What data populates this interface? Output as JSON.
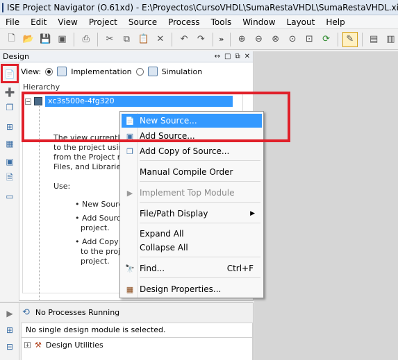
{
  "window": {
    "title": "ISE Project Navigator (O.61xd) - E:\\Proyectos\\CursoVHDL\\SumaRestaVHDL\\SumaRestaVHDL.xise"
  },
  "menubar": [
    "File",
    "Edit",
    "View",
    "Project",
    "Source",
    "Process",
    "Tools",
    "Window",
    "Layout",
    "Help"
  ],
  "toolbar": {
    "left_icons": [
      "new-file-icon",
      "open-folder-icon",
      "save-icon",
      "save-all-icon",
      "print-icon",
      "cut-icon",
      "copy-icon",
      "paste-icon",
      "delete-icon",
      "undo-icon",
      "redo-icon"
    ],
    "more": "»",
    "right_icons": [
      "zoom-in-icon",
      "zoom-out-icon",
      "zoom-fit-icon",
      "zoom-full-icon",
      "zoom-area-icon",
      "refresh-icon",
      "design-goals-icon",
      "pencil-icon",
      "cascade-windows-icon",
      "tile-horizontal-icon",
      "tile-vertical-icon"
    ]
  },
  "design_panel": {
    "title": "Design",
    "controls": [
      "↔",
      "□",
      "⧉",
      "✕"
    ],
    "view_label": "View:",
    "implementation_label": "Implementation",
    "simulation_label": "Simulation",
    "hierarchy_label": "Hierarchy",
    "device": "xc3s500e-4fg320",
    "description_lines": [
      "The view currently c",
      "to the project using",
      "from the Project me",
      "Files, and Libraries p"
    ],
    "use_label": "Use:",
    "bullets": [
      [
        "New Source"
      ],
      [
        "Add Source",
        "project."
      ],
      [
        "Add Copy o",
        "to the proje",
        "project."
      ]
    ]
  },
  "context_menu": {
    "items": [
      {
        "label": "New Source...",
        "icon": "new-source-icon",
        "highlighted": true
      },
      {
        "label": "Add Source...",
        "icon": "add-source-icon"
      },
      {
        "label": "Add Copy of Source...",
        "icon": "add-copy-icon"
      },
      {
        "label": "Manual Compile Order"
      },
      {
        "label": "Implement Top Module",
        "icon": "play-icon",
        "disabled": true
      },
      {
        "label": "File/Path Display",
        "submenu": true
      },
      {
        "label": "Expand All"
      },
      {
        "label": "Collapse All"
      },
      {
        "label": "Find...",
        "icon": "binoculars-icon",
        "shortcut": "Ctrl+F"
      },
      {
        "label": "Design Properties...",
        "icon": "properties-icon"
      }
    ]
  },
  "processes_panel": {
    "status": "No Processes Running",
    "message": "No single design module is selected.",
    "row_label": "Design Utilities"
  },
  "colors": {
    "highlight": "#3399ff",
    "callout_red": "#e0202a"
  }
}
